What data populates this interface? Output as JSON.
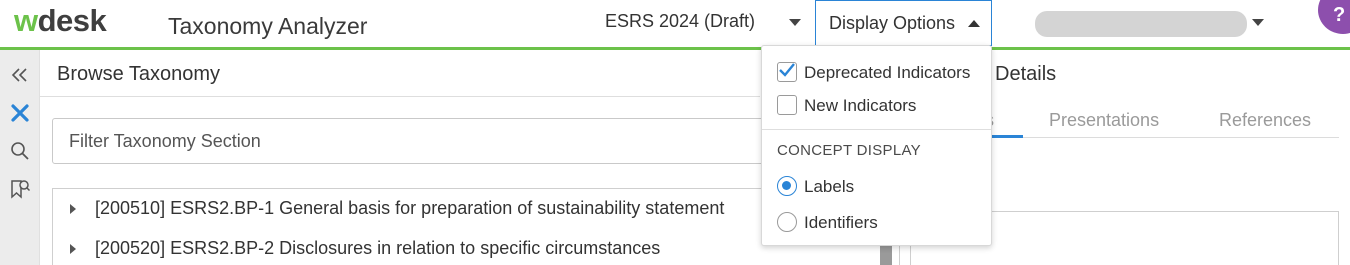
{
  "header": {
    "logo_w": "w",
    "logo_rest": "desk",
    "app_title": "Taxonomy Analyzer",
    "taxonomy_version": "ESRS 2024 (Draft)",
    "display_options_label": "Display Options",
    "help_label": "?"
  },
  "browse": {
    "title": "Browse Taxonomy",
    "filter_placeholder": "Filter Taxonomy Section",
    "rows": [
      {
        "label": "[200510] ESRS2.BP-1 General basis for preparation of sustainability statement"
      },
      {
        "label": "[200520] ESRS2.BP-2 Disclosures in relation to specific circumstances"
      }
    ]
  },
  "details": {
    "title": "Details",
    "tabs": [
      {
        "label": "s",
        "active": true
      },
      {
        "label": "Presentations",
        "active": false
      },
      {
        "label": "References",
        "active": false
      }
    ]
  },
  "display_options": {
    "checkboxes": [
      {
        "label": "Deprecated Indicators",
        "checked": true
      },
      {
        "label": "New Indicators",
        "checked": false
      }
    ],
    "concept_display_heading": "CONCEPT DISPLAY",
    "radios": [
      {
        "label": "Labels",
        "selected": true
      },
      {
        "label": "Identifiers",
        "selected": false
      }
    ]
  },
  "colors": {
    "brand_green": "#6cc24a",
    "accent_blue": "#2a84d6",
    "help_purple": "#8d4fad"
  }
}
